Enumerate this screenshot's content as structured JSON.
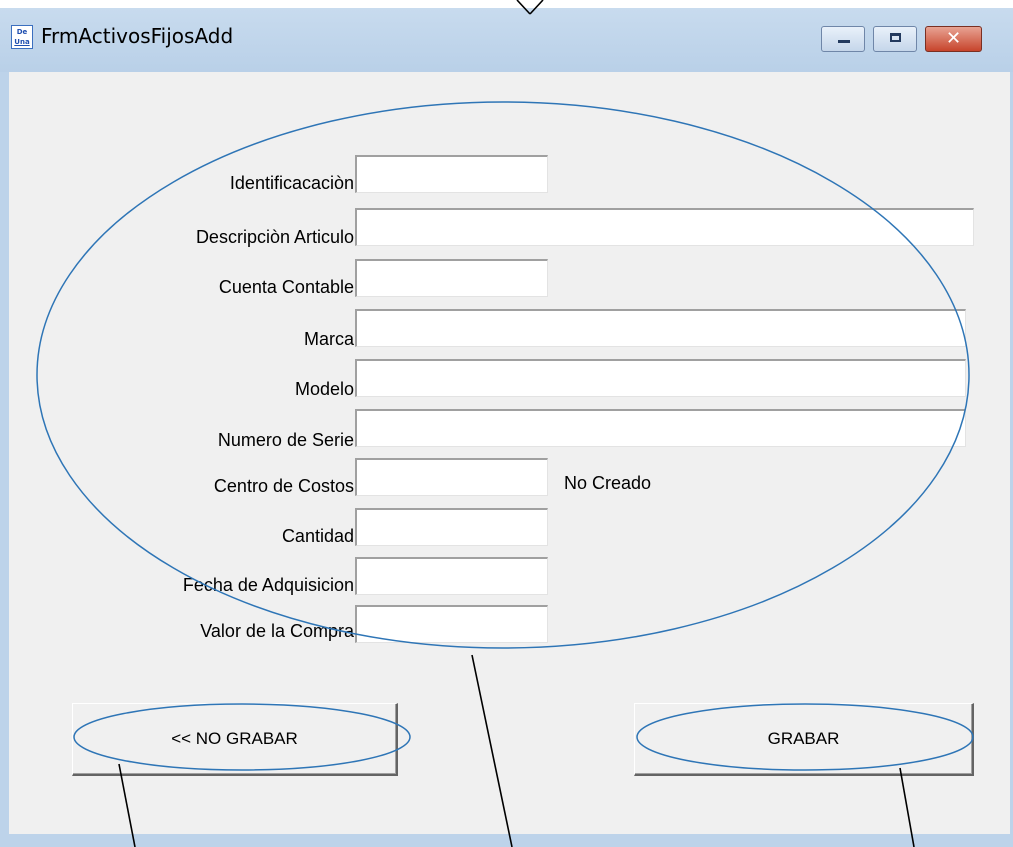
{
  "window": {
    "title": "FrmActivosFijosAdd",
    "icon_text_top": "De",
    "icon_text_bottom": "Una",
    "controls": {
      "minimize": "minimize-icon",
      "maximize": "maximize-icon",
      "close": "close-icon"
    }
  },
  "form": {
    "fields": [
      {
        "label": "Identificacaciòn",
        "value": ""
      },
      {
        "label": "Descripciòn Articulo",
        "value": ""
      },
      {
        "label": "Cuenta Contable",
        "value": ""
      },
      {
        "label": "Marca",
        "value": ""
      },
      {
        "label": "Modelo",
        "value": ""
      },
      {
        "label": "Numero de Serie",
        "value": ""
      },
      {
        "label": "Centro de Costos",
        "value": ""
      },
      {
        "label": "Cantidad",
        "value": ""
      },
      {
        "label": "Fecha de Adquisicion",
        "value": ""
      },
      {
        "label": "Valor de la Compra",
        "value": ""
      }
    ],
    "cost_center_status": "No Creado"
  },
  "buttons": {
    "cancel": "<< NO GRABAR",
    "save": "GRABAR"
  },
  "annotation_color": "#2e75b6"
}
